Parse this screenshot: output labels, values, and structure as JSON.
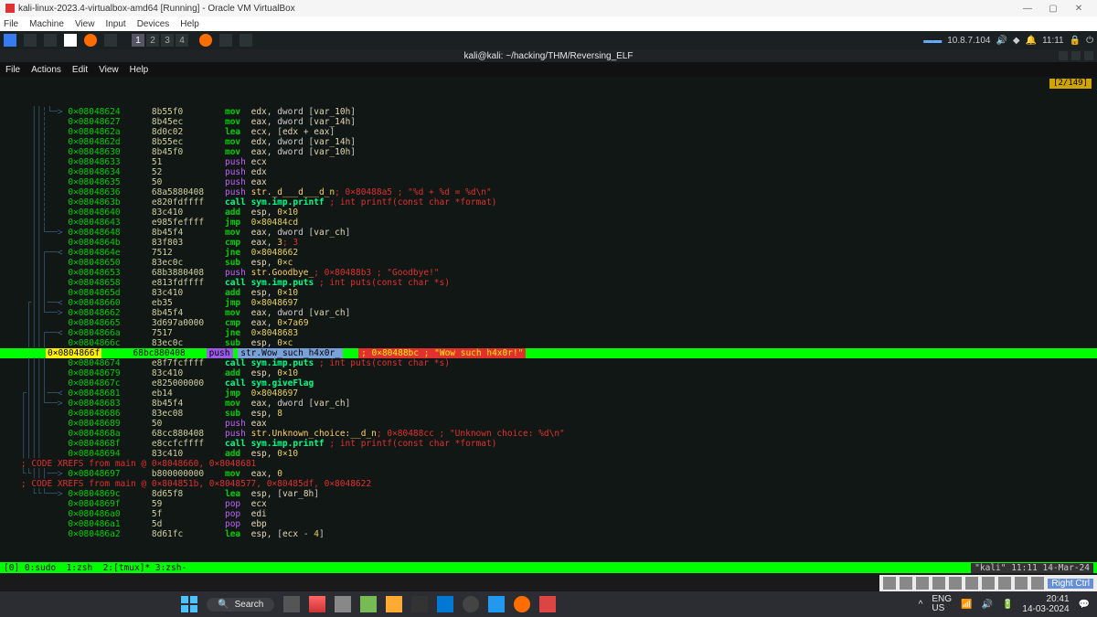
{
  "vbox": {
    "title": "kali-linux-2023.4-virtualbox-amd64 [Running] - Oracle VM VirtualBox",
    "menu": [
      "File",
      "Machine",
      "View",
      "Input",
      "Devices",
      "Help"
    ]
  },
  "kaliTopbar": {
    "workspaces": [
      "1",
      "2",
      "3",
      "4"
    ],
    "activeWs": "1",
    "ip": "10.8.7.104",
    "time": "11:11"
  },
  "terminal": {
    "title": "kali@kali: ~/hacking/THM/Reversing_ELF",
    "menu": [
      "File",
      "Actions",
      "Edit",
      "View",
      "Help"
    ],
    "posBadge": "[2/149]"
  },
  "asm": [
    {
      "tree": "      ││╎└─> ",
      "addr": "0×08048624",
      "sp": 6,
      "hex": "8b55f0",
      "mclass": "mnem",
      "mnem": "mov",
      "args": [
        {
          "t": "arg-w",
          "v": "edx"
        },
        {
          "t": "txt",
          "v": ", dword ["
        },
        {
          "t": "var",
          "v": "var_10h"
        },
        {
          "t": "txt",
          "v": "]"
        }
      ]
    },
    {
      "tree": "      ││╎    ",
      "addr": "0×08048627",
      "sp": 6,
      "hex": "8b45ec",
      "mclass": "mnem",
      "mnem": "mov",
      "args": [
        {
          "t": "arg-w",
          "v": "eax"
        },
        {
          "t": "txt",
          "v": ", dword ["
        },
        {
          "t": "var",
          "v": "var_14h"
        },
        {
          "t": "txt",
          "v": "]"
        }
      ]
    },
    {
      "tree": "      ││╎    ",
      "addr": "0×0804862a",
      "sp": 6,
      "hex": "8d0c02",
      "mclass": "mnem",
      "mnem": "lea",
      "args": [
        {
          "t": "arg-w",
          "v": "ecx"
        },
        {
          "t": "txt",
          "v": ", ["
        },
        {
          "t": "arg-w",
          "v": "edx"
        },
        {
          "t": "txt",
          "v": " + "
        },
        {
          "t": "arg-w",
          "v": "eax"
        },
        {
          "t": "txt",
          "v": "]"
        }
      ]
    },
    {
      "tree": "      ││╎    ",
      "addr": "0×0804862d",
      "sp": 6,
      "hex": "8b55ec",
      "mclass": "mnem",
      "mnem": "mov",
      "args": [
        {
          "t": "arg-w",
          "v": "edx"
        },
        {
          "t": "txt",
          "v": ", dword ["
        },
        {
          "t": "var",
          "v": "var_14h"
        },
        {
          "t": "txt",
          "v": "]"
        }
      ]
    },
    {
      "tree": "      ││╎    ",
      "addr": "0×08048630",
      "sp": 6,
      "hex": "8b45f0",
      "mclass": "mnem",
      "mnem": "mov",
      "args": [
        {
          "t": "arg-w",
          "v": "eax"
        },
        {
          "t": "txt",
          "v": ", dword ["
        },
        {
          "t": "var",
          "v": "var_10h"
        },
        {
          "t": "txt",
          "v": "]"
        }
      ]
    },
    {
      "tree": "      ││╎    ",
      "addr": "0×08048633",
      "sp": 6,
      "hex": "51",
      "mclass": "mnem-p",
      "mnem": "push",
      "args": [
        {
          "t": "arg-w",
          "v": "ecx"
        }
      ]
    },
    {
      "tree": "      ││╎    ",
      "addr": "0×08048634",
      "sp": 6,
      "hex": "52",
      "mclass": "mnem-p",
      "mnem": "push",
      "args": [
        {
          "t": "arg-w",
          "v": "edx"
        }
      ]
    },
    {
      "tree": "      ││╎    ",
      "addr": "0×08048635",
      "sp": 6,
      "hex": "50",
      "mclass": "mnem-p",
      "mnem": "push",
      "args": [
        {
          "t": "arg-w",
          "v": "eax"
        }
      ]
    },
    {
      "tree": "      ││╎    ",
      "addr": "0×08048636",
      "sp": 6,
      "hex": "68a5880408",
      "mclass": "mnem-p",
      "mnem": "push",
      "args": [
        {
          "t": "arg",
          "v": "str._d___d___d_n"
        }
      ],
      "comment": "; 0×80488a5 ; \"%d + %d = %d\\n\""
    },
    {
      "tree": "      ││╎    ",
      "addr": "0×0804863b",
      "sp": 6,
      "hex": "e820fdffff",
      "mclass": "mnem-c",
      "mnem": "call sym.imp.printf",
      "args": [],
      "comment": "; int printf(const char *format)"
    },
    {
      "tree": "      ││╎    ",
      "addr": "0×08048640",
      "sp": 6,
      "hex": "83c410",
      "mclass": "mnem",
      "mnem": "add",
      "args": [
        {
          "t": "arg-w",
          "v": "esp"
        },
        {
          "t": "txt",
          "v": ", "
        },
        {
          "t": "num",
          "v": "0×10"
        }
      ]
    },
    {
      "tree": "      ││╎    ",
      "addr": "0×08048643",
      "sp": 6,
      "hex": "e985feffff",
      "mclass": "mnem",
      "mnem": "jmp",
      "args": [
        {
          "t": "num",
          "v": "0×80484cd"
        }
      ]
    },
    {
      "tree": "      ││└──> ",
      "addr": "0×08048648",
      "sp": 6,
      "hex": "8b45f4",
      "mclass": "mnem",
      "mnem": "mov",
      "args": [
        {
          "t": "arg-w",
          "v": "eax"
        },
        {
          "t": "txt",
          "v": ", dword ["
        },
        {
          "t": "var",
          "v": "var_ch"
        },
        {
          "t": "txt",
          "v": "]"
        }
      ]
    },
    {
      "tree": "      ││     ",
      "addr": "0×0804864b",
      "sp": 6,
      "hex": "83f803",
      "mclass": "mnem",
      "mnem": "cmp",
      "args": [
        {
          "t": "arg-w",
          "v": "eax"
        },
        {
          "t": "txt",
          "v": ", "
        },
        {
          "t": "num",
          "v": "3"
        }
      ],
      "comment": "; 3"
    },
    {
      "tree": "      ││┌──< ",
      "addr": "0×0804864e",
      "sp": 6,
      "hex": "7512",
      "mclass": "mnem",
      "mnem": "jne",
      "args": [
        {
          "t": "num",
          "v": "0×8048662"
        }
      ]
    },
    {
      "tree": "      │││    ",
      "addr": "0×08048650",
      "sp": 6,
      "hex": "83ec0c",
      "mclass": "mnem",
      "mnem": "sub",
      "args": [
        {
          "t": "arg-w",
          "v": "esp"
        },
        {
          "t": "txt",
          "v": ", "
        },
        {
          "t": "num",
          "v": "0×c"
        }
      ]
    },
    {
      "tree": "      │││    ",
      "addr": "0×08048653",
      "sp": 6,
      "hex": "68b3880408",
      "mclass": "mnem-p",
      "mnem": "push",
      "args": [
        {
          "t": "arg",
          "v": "str.Goodbye_"
        }
      ],
      "comment": "; 0×80488b3 ; \"Goodbye!\""
    },
    {
      "tree": "      │││    ",
      "addr": "0×08048658",
      "sp": 6,
      "hex": "e813fdffff",
      "mclass": "mnem-c",
      "mnem": "call sym.imp.puts",
      "args": [],
      "comment": "; int puts(const char *s)"
    },
    {
      "tree": "      │││    ",
      "addr": "0×0804865d",
      "sp": 6,
      "hex": "83c410",
      "mclass": "mnem",
      "mnem": "add",
      "args": [
        {
          "t": "arg-w",
          "v": "esp"
        },
        {
          "t": "txt",
          "v": ", "
        },
        {
          "t": "num",
          "v": "0×10"
        }
      ]
    },
    {
      "tree": "     ┌│││──< ",
      "addr": "0×08048660",
      "sp": 6,
      "hex": "eb35",
      "mclass": "mnem",
      "mnem": "jmp",
      "args": [
        {
          "t": "num",
          "v": "0×8048697"
        }
      ]
    },
    {
      "tree": "     │││└──> ",
      "addr": "0×08048662",
      "sp": 6,
      "hex": "8b45f4",
      "mclass": "mnem",
      "mnem": "mov",
      "args": [
        {
          "t": "arg-w",
          "v": "eax"
        },
        {
          "t": "txt",
          "v": ", dword ["
        },
        {
          "t": "var",
          "v": "var_ch"
        },
        {
          "t": "txt",
          "v": "]"
        }
      ]
    },
    {
      "tree": "     │││     ",
      "addr": "0×08048665",
      "sp": 6,
      "hex": "3d697a0000",
      "mclass": "mnem",
      "mnem": "cmp",
      "args": [
        {
          "t": "arg-w",
          "v": "eax"
        },
        {
          "t": "txt",
          "v": ", "
        },
        {
          "t": "num",
          "v": "0×7a69"
        }
      ]
    },
    {
      "tree": "     │││┌──< ",
      "addr": "0×0804866a",
      "sp": 6,
      "hex": "7517",
      "mclass": "mnem",
      "mnem": "jne",
      "args": [
        {
          "t": "num",
          "v": "0×8048683"
        }
      ]
    },
    {
      "tree": "     ││││    ",
      "addr": "0×0804866c",
      "sp": 6,
      "hex": "83ec0c",
      "mclass": "mnem",
      "mnem": "sub",
      "args": [
        {
          "t": "arg-w",
          "v": "esp"
        },
        {
          "t": "txt",
          "v": ", "
        },
        {
          "t": "num",
          "v": "0×c"
        }
      ]
    },
    {
      "tree": "HL",
      "addr": "0×0804866f",
      "hex": "68bc880408",
      "mnem": "push",
      "str": "str.Wow_such_h4x0r_",
      "comment": "; 0×80488bc ; \"Wow such h4x0r!\""
    },
    {
      "tree": "     ││││    ",
      "addr": "0×08048674",
      "sp": 6,
      "hex": "e8f7fcffff",
      "mclass": "mnem-c",
      "mnem": "call sym.imp.puts",
      "args": [],
      "comment": "; int puts(const char *s)"
    },
    {
      "tree": "     ││││    ",
      "addr": "0×08048679",
      "sp": 6,
      "hex": "83c410",
      "mclass": "mnem",
      "mnem": "add",
      "args": [
        {
          "t": "arg-w",
          "v": "esp"
        },
        {
          "t": "txt",
          "v": ", "
        },
        {
          "t": "num",
          "v": "0×10"
        }
      ]
    },
    {
      "tree": "     ││││    ",
      "addr": "0×0804867c",
      "sp": 6,
      "hex": "e825000000",
      "mclass": "mnem-c",
      "mnem": "call sym.giveFlag",
      "args": []
    },
    {
      "tree": "    ┌││││──< ",
      "addr": "0×08048681",
      "sp": 6,
      "hex": "eb14",
      "mclass": "mnem",
      "mnem": "jmp",
      "args": [
        {
          "t": "num",
          "v": "0×8048697"
        }
      ]
    },
    {
      "tree": "    ││││└──> ",
      "addr": "0×08048683",
      "sp": 6,
      "hex": "8b45f4",
      "mclass": "mnem",
      "mnem": "mov",
      "args": [
        {
          "t": "arg-w",
          "v": "eax"
        },
        {
          "t": "txt",
          "v": ", dword ["
        },
        {
          "t": "var",
          "v": "var_ch"
        },
        {
          "t": "txt",
          "v": "]"
        }
      ]
    },
    {
      "tree": "    ││││     ",
      "addr": "0×08048686",
      "sp": 6,
      "hex": "83ec08",
      "mclass": "mnem",
      "mnem": "sub",
      "args": [
        {
          "t": "arg-w",
          "v": "esp"
        },
        {
          "t": "txt",
          "v": ", "
        },
        {
          "t": "num",
          "v": "8"
        }
      ]
    },
    {
      "tree": "    ││││     ",
      "addr": "0×08048689",
      "sp": 6,
      "hex": "50",
      "mclass": "mnem-p",
      "mnem": "push",
      "args": [
        {
          "t": "arg-w",
          "v": "eax"
        }
      ]
    },
    {
      "tree": "    ││││     ",
      "addr": "0×0804868a",
      "sp": 6,
      "hex": "68cc880408",
      "mclass": "mnem-p",
      "mnem": "push",
      "args": [
        {
          "t": "arg",
          "v": "str.Unknown_choice:__d_n"
        }
      ],
      "comment": "; 0×80488cc ; \"Unknown choice: %d\\n\""
    },
    {
      "tree": "    ││││     ",
      "addr": "0×0804868f",
      "sp": 6,
      "hex": "e8ccfcffff",
      "mclass": "mnem-c",
      "mnem": "call sym.imp.printf",
      "args": [],
      "comment": "; int printf(const char *format)"
    },
    {
      "tree": "    ││││     ",
      "addr": "0×08048694",
      "sp": 6,
      "hex": "83c410",
      "mclass": "mnem",
      "mnem": "add",
      "args": [
        {
          "t": "arg-w",
          "v": "esp"
        },
        {
          "t": "txt",
          "v": ", "
        },
        {
          "t": "num",
          "v": "0×10"
        }
      ]
    },
    {
      "tree": "XREF",
      "text": "    ; CODE XREFS from main @ 0×8048660, 0×8048681"
    },
    {
      "tree": "    └└│││──> ",
      "addr": "0×08048697",
      "sp": 6,
      "hex": "b800000000",
      "mclass": "mnem",
      "mnem": "mov",
      "args": [
        {
          "t": "arg-w",
          "v": "eax"
        },
        {
          "t": "txt",
          "v": ", "
        },
        {
          "t": "num",
          "v": "0"
        }
      ]
    },
    {
      "tree": "XREF",
      "text": "    ; CODE XREFS from main @ 0×804851b, 0×8048577, 0×80485df, 0×8048622"
    },
    {
      "tree": "      └└└──> ",
      "addr": "0×0804869c",
      "sp": 6,
      "hex": "8d65f8",
      "mclass": "mnem",
      "mnem": "lea",
      "args": [
        {
          "t": "arg-w",
          "v": "esp"
        },
        {
          "t": "txt",
          "v": ", ["
        },
        {
          "t": "var",
          "v": "var_8h"
        },
        {
          "t": "txt",
          "v": "]"
        }
      ]
    },
    {
      "tree": "             ",
      "addr": "0×0804869f",
      "sp": 6,
      "hex": "59",
      "mclass": "mnem-p",
      "mnem": "pop",
      "args": [
        {
          "t": "arg-w",
          "v": "ecx"
        }
      ]
    },
    {
      "tree": "             ",
      "addr": "0×080486a0",
      "sp": 6,
      "hex": "5f",
      "mclass": "mnem-p",
      "mnem": "pop",
      "args": [
        {
          "t": "arg-w",
          "v": "edi"
        }
      ]
    },
    {
      "tree": "             ",
      "addr": "0×080486a1",
      "sp": 6,
      "hex": "5d",
      "mclass": "mnem-p",
      "mnem": "pop",
      "args": [
        {
          "t": "arg-w",
          "v": "ebp"
        }
      ]
    },
    {
      "tree": "             ",
      "addr": "0×080486a2",
      "sp": 6,
      "hex": "8d61fc",
      "mclass": "mnem",
      "mnem": "lea",
      "args": [
        {
          "t": "arg-w",
          "v": "esp"
        },
        {
          "t": "txt",
          "v": ", ["
        },
        {
          "t": "arg-w",
          "v": "ecx"
        },
        {
          "t": "txt",
          "v": " - "
        },
        {
          "t": "num",
          "v": "4"
        },
        {
          "t": "txt",
          "v": "]"
        }
      ]
    }
  ],
  "tmux": {
    "left": "[0] 0:sudo  1:zsh  2:[tmux]* 3:zsh-",
    "right": "\"kali\" 11:11 14-Mar-24"
  },
  "statusBar": {
    "rightCtrl": "Right Ctrl"
  },
  "taskbar": {
    "search_placeholder": "Search",
    "lang": "ENG",
    "region": "US",
    "clock_time": "20:41",
    "clock_date": "14-03-2024"
  }
}
